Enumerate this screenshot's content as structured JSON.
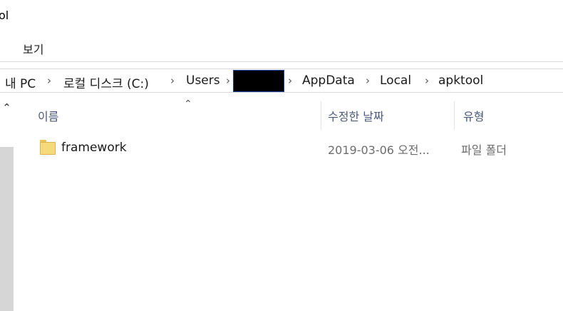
{
  "window": {
    "title_fragment": "ol"
  },
  "ribbon": {
    "tabs": [
      {
        "label": "보기"
      }
    ]
  },
  "address_bar": {
    "crumbs": [
      "내 PC",
      "로컬 디스크 (C:)",
      "Users",
      "AppData",
      "Local",
      "apktool"
    ]
  },
  "columns": [
    {
      "label": "이름"
    },
    {
      "label": "수정한 날짜"
    },
    {
      "label": "유형"
    }
  ],
  "files": [
    {
      "name": "framework",
      "modified": "2019-03-06 오전...",
      "type": "파일 폴더",
      "icon": "folder-icon"
    }
  ],
  "colors": {
    "folder": "#f6d97a",
    "header_text": "#4a5a78",
    "redaction": "#000000"
  }
}
